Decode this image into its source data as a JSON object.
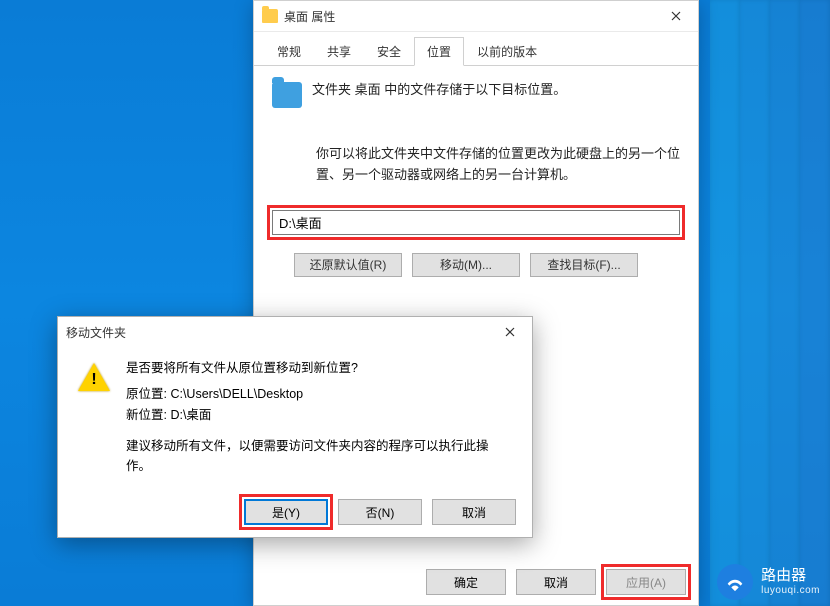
{
  "props": {
    "title": "桌面 属性",
    "tabs": {
      "general": "常规",
      "share": "共享",
      "security": "安全",
      "location": "位置",
      "previous": "以前的版本"
    },
    "location_tab": {
      "line1": "文件夹 桌面 中的文件存储于以下目标位置。",
      "line2": "你可以将此文件夹中文件存储的位置更改为此硬盘上的另一个位置、另一个驱动器或网络上的另一台计算机。",
      "path_value": "D:\\桌面",
      "restore_btn": "还原默认值(R)",
      "move_btn": "移动(M)...",
      "find_btn": "查找目标(F)..."
    },
    "footer": {
      "ok": "确定",
      "cancel": "取消",
      "apply": "应用(A)"
    }
  },
  "dialog": {
    "title": "移动文件夹",
    "question": "是否要将所有文件从原位置移动到新位置?",
    "orig_label": "原位置: ",
    "orig_value": "C:\\Users\\DELL\\Desktop",
    "new_label": "新位置: ",
    "new_value": "D:\\桌面",
    "advice": "建议移动所有文件，以便需要访问文件夹内容的程序可以执行此操作。",
    "yes": "是(Y)",
    "no": "否(N)",
    "cancel": "取消"
  },
  "watermark": {
    "brand": "路由器",
    "domain": "luyouqi.com"
  }
}
